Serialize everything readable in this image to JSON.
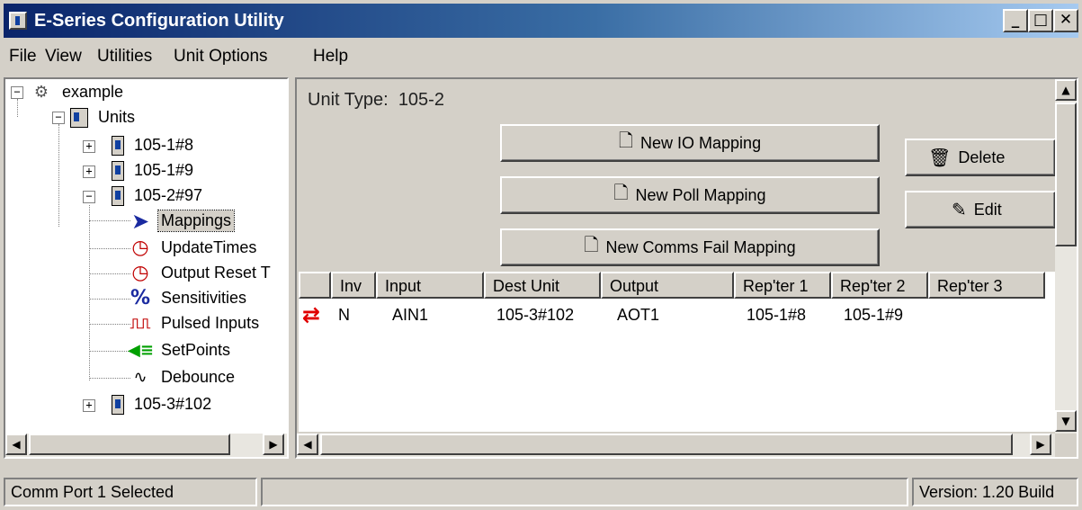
{
  "window": {
    "title": "E-Series Configuration Utility"
  },
  "menu": [
    "File",
    "View",
    "Utilities",
    "Unit Options",
    "Help"
  ],
  "tree": {
    "root": "example",
    "units_label": "Units",
    "units": [
      "105-1#8",
      "105-1#9",
      "105-2#97",
      "105-3#102"
    ],
    "children": [
      "Mappings",
      "UpdateTimes",
      "Output Reset T",
      "Sensitivities",
      "Pulsed Inputs",
      "SetPoints",
      "Debounce"
    ]
  },
  "panel": {
    "unit_type_label": "Unit Type:",
    "unit_type_value": "105-2",
    "buttons": {
      "new_io": "New IO Mapping",
      "new_poll": "New Poll Mapping",
      "new_comms": "New Comms Fail Mapping",
      "delete": "Delete",
      "edit": "Edit"
    }
  },
  "table": {
    "columns": [
      "",
      "Inv",
      "Input",
      "Dest Unit",
      "Output",
      "Rep'ter 1",
      "Rep'ter 2",
      "Rep'ter 3"
    ],
    "rows": [
      {
        "inv": "N",
        "input": "AIN1",
        "dest": "105-3#102",
        "output": "AOT1",
        "r1": "105-1#8",
        "r2": "105-1#9",
        "r3": ""
      }
    ]
  },
  "status": {
    "left": "Comm Port 1 Selected",
    "right": "Version: 1.20 Build"
  },
  "colors": {
    "title_start": "#0a246a",
    "title_end": "#a6caf0",
    "face": "#d4d0c8",
    "mapping_arrow": "#e00000"
  }
}
